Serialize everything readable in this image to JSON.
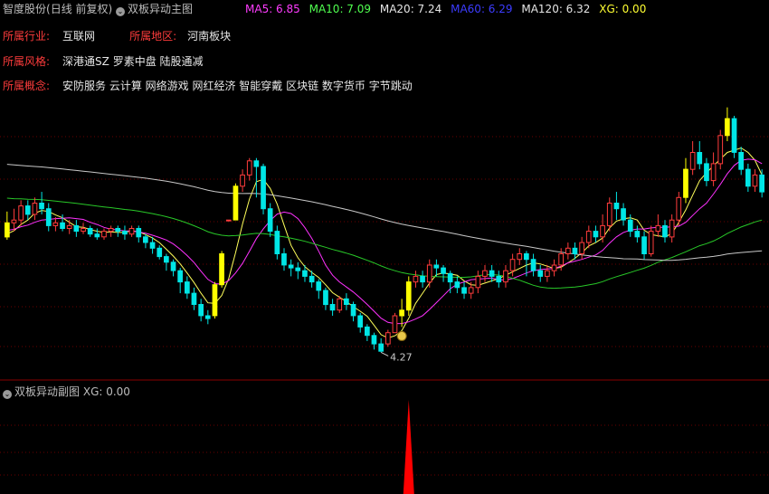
{
  "header": {
    "stock_name": "智度股份",
    "period": "(日线 前复权)",
    "main_indicator": "双板异动主图",
    "ma": [
      {
        "label": "MA5: 6.85",
        "color": "#ff3cff"
      },
      {
        "label": "MA10: 7.09",
        "color": "#50ff50"
      },
      {
        "label": "MA20: 7.24",
        "color": "#e6e6e6"
      },
      {
        "label": "MA60: 6.29",
        "color": "#3c3cff"
      },
      {
        "label": "MA120: 6.32",
        "color": "#e6e6e6"
      },
      {
        "label": "XG: 0.00",
        "color": "#ffff32"
      }
    ]
  },
  "info": {
    "industry_label": "所属行业:",
    "industry_value": "互联网",
    "region_label": "所属地区:",
    "region_value": "河南板块",
    "style_label": "所属风格:",
    "style_value": "深港通SZ 罗素中盘 陆股通减",
    "concept_label": "所属概念:",
    "concept_value": "安防服务 云计算 网络游戏 网红经济 智能穿戴 区块链 数字货币 字节跳动"
  },
  "sub_header": {
    "indicator": "双板异动副图",
    "xg": "XG: 0.00"
  },
  "colors": {
    "up": "#ff3c3c",
    "down": "#00e6e6",
    "signal": "#ffff00",
    "ma_short": "#ffff5a",
    "ma_mid": "#ff32ff",
    "ma_60": "#28c828",
    "ma_long": "#c8c8c8",
    "spike": "#ff0000"
  },
  "chart_data": {
    "type": "candlestick",
    "ylim": [
      4.0,
      8.9
    ],
    "low_annotation": "4.27",
    "low_annotation_value": 4.27,
    "bars": [
      [
        6.3,
        6.55,
        6.25,
        6.75,
        1
      ],
      [
        6.55,
        6.6,
        6.4,
        6.8,
        0
      ],
      [
        6.6,
        6.85,
        6.5,
        6.95,
        0
      ],
      [
        6.85,
        6.7,
        6.6,
        6.95,
        0
      ],
      [
        6.7,
        6.9,
        6.6,
        7.0,
        0
      ],
      [
        6.9,
        6.8,
        6.7,
        7.1,
        0
      ],
      [
        6.8,
        6.5,
        6.4,
        6.9,
        0
      ],
      [
        6.5,
        6.55,
        6.4,
        6.65,
        0
      ],
      [
        6.55,
        6.45,
        6.4,
        6.7,
        0
      ],
      [
        6.45,
        6.5,
        6.35,
        6.6,
        0
      ],
      [
        6.5,
        6.4,
        6.3,
        6.6,
        0
      ],
      [
        6.4,
        6.45,
        6.35,
        6.55,
        0
      ],
      [
        6.45,
        6.35,
        6.3,
        6.5,
        0
      ],
      [
        6.35,
        6.3,
        6.25,
        6.45,
        0
      ],
      [
        6.3,
        6.4,
        6.25,
        6.45,
        0
      ],
      [
        6.4,
        6.45,
        6.3,
        6.5,
        0
      ],
      [
        6.45,
        6.4,
        6.3,
        6.5,
        0
      ],
      [
        6.4,
        6.35,
        6.25,
        6.5,
        0
      ],
      [
        6.35,
        6.45,
        6.3,
        6.5,
        0
      ],
      [
        6.45,
        6.3,
        6.2,
        6.5,
        0
      ],
      [
        6.3,
        6.2,
        6.1,
        6.35,
        0
      ],
      [
        6.2,
        6.1,
        6.0,
        6.3,
        0
      ],
      [
        6.1,
        5.95,
        5.9,
        6.15,
        0
      ],
      [
        5.95,
        5.85,
        5.7,
        6.0,
        0
      ],
      [
        5.85,
        5.7,
        5.6,
        5.9,
        0
      ],
      [
        5.7,
        5.5,
        5.3,
        5.75,
        0
      ],
      [
        5.5,
        5.3,
        5.2,
        5.6,
        0
      ],
      [
        5.3,
        5.1,
        5.0,
        5.4,
        0
      ],
      [
        5.1,
        4.9,
        4.8,
        5.2,
        0
      ],
      [
        4.9,
        4.85,
        4.75,
        5.0,
        0
      ],
      [
        4.9,
        5.45,
        4.85,
        5.5,
        1
      ],
      [
        5.45,
        6.0,
        5.4,
        6.05,
        1
      ],
      [
        6.6,
        6.6,
        6.6,
        6.6,
        0
      ],
      [
        6.6,
        7.2,
        6.6,
        7.25,
        1
      ],
      [
        7.2,
        7.4,
        7.1,
        7.5,
        0
      ],
      [
        7.4,
        7.65,
        7.3,
        7.7,
        0
      ],
      [
        7.65,
        7.55,
        7.0,
        7.7,
        0
      ],
      [
        7.55,
        6.8,
        6.7,
        7.6,
        0
      ],
      [
        6.8,
        6.4,
        6.3,
        6.9,
        0
      ],
      [
        6.4,
        6.0,
        5.9,
        6.5,
        0
      ],
      [
        6.0,
        5.8,
        5.7,
        6.1,
        0
      ],
      [
        5.8,
        5.75,
        5.6,
        5.9,
        0
      ],
      [
        5.75,
        5.7,
        5.55,
        5.85,
        0
      ],
      [
        5.7,
        5.6,
        5.5,
        5.8,
        0
      ],
      [
        5.6,
        5.5,
        5.4,
        5.7,
        0
      ],
      [
        5.5,
        5.35,
        5.2,
        5.55,
        0
      ],
      [
        5.35,
        5.1,
        5.0,
        5.4,
        0
      ],
      [
        5.1,
        5.0,
        4.9,
        5.2,
        0
      ],
      [
        5.0,
        5.2,
        4.95,
        5.25,
        1
      ],
      [
        5.2,
        5.1,
        5.0,
        5.3,
        0
      ],
      [
        5.1,
        4.9,
        4.8,
        5.15,
        0
      ],
      [
        4.9,
        4.7,
        4.6,
        4.95,
        0
      ],
      [
        4.7,
        4.55,
        4.45,
        4.75,
        0
      ],
      [
        4.55,
        4.4,
        4.3,
        4.6,
        0
      ],
      [
        4.4,
        4.27,
        4.25,
        4.5,
        0
      ],
      [
        4.4,
        4.6,
        4.35,
        4.65,
        1
      ],
      [
        4.6,
        4.9,
        4.6,
        4.95,
        1
      ],
      [
        4.9,
        5.0,
        4.7,
        5.2,
        0
      ],
      [
        5.0,
        5.5,
        4.9,
        5.6,
        1
      ],
      [
        5.5,
        5.6,
        5.4,
        5.7,
        0
      ],
      [
        5.6,
        5.5,
        5.4,
        5.7,
        0
      ],
      [
        5.5,
        5.8,
        5.4,
        5.9,
        1
      ],
      [
        5.8,
        5.75,
        5.6,
        5.9,
        0
      ],
      [
        5.75,
        5.65,
        5.5,
        5.8,
        0
      ],
      [
        5.65,
        5.5,
        5.3,
        5.7,
        0
      ],
      [
        5.5,
        5.4,
        5.3,
        5.6,
        0
      ],
      [
        5.4,
        5.3,
        5.2,
        5.5,
        0
      ],
      [
        5.3,
        5.4,
        5.2,
        5.5,
        1
      ],
      [
        5.4,
        5.6,
        5.3,
        5.7,
        1
      ],
      [
        5.6,
        5.7,
        5.5,
        5.8,
        1
      ],
      [
        5.7,
        5.6,
        5.5,
        5.8,
        0
      ],
      [
        5.6,
        5.5,
        5.4,
        5.7,
        0
      ],
      [
        5.5,
        5.7,
        5.4,
        5.8,
        1
      ],
      [
        5.7,
        5.9,
        5.6,
        6.0,
        1
      ],
      [
        5.9,
        6.0,
        5.8,
        6.1,
        1
      ],
      [
        6.0,
        5.9,
        5.6,
        6.05,
        0
      ],
      [
        5.9,
        5.7,
        5.6,
        6.0,
        0
      ],
      [
        5.7,
        5.6,
        5.5,
        5.8,
        0
      ],
      [
        5.6,
        5.7,
        5.5,
        5.8,
        1
      ],
      [
        5.7,
        5.8,
        5.6,
        5.9,
        1
      ],
      [
        5.8,
        6.0,
        5.7,
        6.1,
        1
      ],
      [
        6.0,
        6.1,
        5.9,
        6.2,
        1
      ],
      [
        6.1,
        6.0,
        5.9,
        6.2,
        0
      ],
      [
        6.0,
        6.2,
        5.9,
        6.3,
        1
      ],
      [
        6.2,
        6.4,
        6.1,
        6.5,
        1
      ],
      [
        6.4,
        6.3,
        6.2,
        6.5,
        0
      ],
      [
        6.3,
        6.5,
        6.2,
        6.7,
        1
      ],
      [
        6.5,
        6.9,
        6.4,
        7.0,
        1
      ],
      [
        6.9,
        6.8,
        6.6,
        7.1,
        0
      ],
      [
        6.8,
        6.6,
        6.5,
        6.9,
        0
      ],
      [
        6.6,
        6.4,
        6.3,
        6.7,
        0
      ],
      [
        6.4,
        6.3,
        6.2,
        6.5,
        0
      ],
      [
        6.3,
        6.0,
        5.9,
        6.4,
        0
      ],
      [
        6.0,
        6.4,
        5.95,
        6.5,
        1
      ],
      [
        6.4,
        6.5,
        6.3,
        6.7,
        1
      ],
      [
        6.5,
        6.3,
        6.2,
        6.6,
        0
      ],
      [
        6.3,
        6.6,
        6.2,
        6.7,
        1
      ],
      [
        6.6,
        7.0,
        6.5,
        7.1,
        1
      ],
      [
        7.0,
        7.5,
        6.9,
        7.7,
        1
      ],
      [
        7.5,
        7.8,
        7.4,
        8.0,
        1
      ],
      [
        7.8,
        7.6,
        7.5,
        8.0,
        0
      ],
      [
        7.6,
        7.3,
        7.2,
        7.7,
        0
      ],
      [
        7.3,
        7.6,
        7.2,
        7.8,
        1
      ],
      [
        7.6,
        8.1,
        7.5,
        8.2,
        1
      ],
      [
        8.1,
        8.4,
        8.0,
        8.6,
        1
      ],
      [
        8.4,
        7.8,
        7.7,
        8.45,
        0
      ],
      [
        7.8,
        7.5,
        7.4,
        7.9,
        0
      ],
      [
        7.5,
        7.2,
        7.1,
        7.6,
        0
      ],
      [
        7.2,
        7.4,
        7.1,
        7.5,
        1
      ],
      [
        7.4,
        7.1,
        7.0,
        7.5,
        0
      ]
    ],
    "signal_bars": [
      0,
      30,
      31,
      33,
      57,
      58,
      98,
      104
    ],
    "sub_spike": {
      "bar": 58,
      "value": 1.0
    }
  }
}
